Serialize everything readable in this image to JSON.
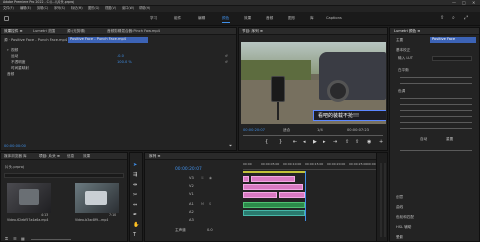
{
  "window": {
    "title": "Adobe Premiere Pro 2022 - C:\\\\...\\\\片头.prproj",
    "controls": [
      "—",
      "□",
      "✕"
    ]
  },
  "menu": [
    "文件(F)",
    "编辑(E)",
    "剪辑(C)",
    "序列(S)",
    "标记(M)",
    "图形(G)",
    "视图(V)",
    "窗口(W)",
    "帮助(H)"
  ],
  "workspaces": [
    "学习",
    "组件",
    "编辑",
    "颜色",
    "效果",
    "音频",
    "图形",
    "库",
    "Captions"
  ],
  "source_panel": {
    "tabs": [
      "效果控件 ≡",
      "Lumetri 范围",
      "源:(无剪辑)",
      "音频剪辑混合器:Pinch Faw.mp4"
    ],
    "clip_tab": "源 · Positive Face - Punch Face.mp4",
    "seq_tab": "Positive Face - Punch Face.mp4",
    "sections": [
      "视频",
      "运动",
      "不透明度",
      "时间重映射",
      "音频"
    ],
    "values": [
      "",
      ".0.0",
      "100.0 %",
      "",
      ""
    ],
    "timecode": "00:00:00:00"
  },
  "program": {
    "title": "节目: 序列 ≡",
    "subtitle": "看吧的装载不抢!!!",
    "timecode_left": "00:00:20:07",
    "fit": "适合",
    "quality": "1/4",
    "timecode_right": "00:00:07:23"
  },
  "lumetri": {
    "title": "Lumetri 颜色 ≡",
    "tabs": [
      "主要",
      "Positive Face"
    ],
    "sections": [
      "基本校正",
      "输入 LUT",
      "白平衡",
      "色调",
      "创意",
      "曲线",
      "色轮和匹配",
      "HSL 辅助",
      "晕影"
    ],
    "bottom": [
      "自动",
      "重置"
    ]
  },
  "project": {
    "title": "项目: 片头 ≡",
    "tabs": [
      "媒体浏览器",
      "库",
      "信息",
      "效果"
    ],
    "search": "片头.prproj",
    "items": [
      "Video-62ebf57a4a6a.mp4",
      "Video-b3ac8f9...mp4"
    ],
    "durations": [
      "4:13",
      "7:10"
    ]
  },
  "timeline": {
    "title": "序列 ≡",
    "timecode": "00:00:20:07",
    "ruler": [
      "00:00",
      "00:00:05:00",
      "00:00:10:00",
      "00:00:15:00",
      "00:00:20:00",
      "00:00:25:00",
      "00:00:30:00"
    ],
    "tracks": [
      "V3",
      "V2",
      "V1",
      "A1",
      "A2",
      "A3",
      "主声道"
    ],
    "master": "0.0"
  },
  "colors": {
    "accent": "#3f8fe8",
    "video_clip": "#d879c2",
    "audio_clip": "#2c8a4a",
    "subtitle": "#5b86ff"
  }
}
